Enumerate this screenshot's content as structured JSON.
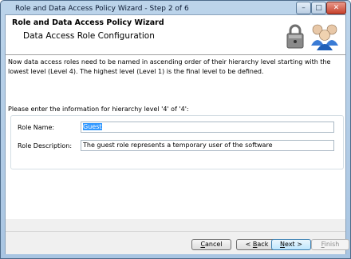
{
  "window": {
    "title": "Role and Data Access Policy Wizard - Step 2 of 6",
    "minimize_glyph": "–",
    "maximize_glyph": "□",
    "close_glyph": "✕"
  },
  "header": {
    "title": "Role and Data Access Policy Wizard",
    "subtitle": "Data Access Role Configuration",
    "icons": [
      "lock-icon",
      "users-icon"
    ]
  },
  "content": {
    "intro": "Now data access roles need to be named in ascending order of their hierarchy level starting with the lowest level (Level 4). The highest level (Level 1) is the final level to be defined.",
    "info": "Please enter the information for hierarchy level '4' of '4':",
    "role_name_label": "Role Name:",
    "role_name_value": "Guest",
    "role_desc_label": "Role Description:",
    "role_desc_value": "The guest role represents a temporary user of the software"
  },
  "buttons": {
    "cancel_u": "C",
    "cancel_rest": "ancel",
    "back_pre": "< ",
    "back_u": "B",
    "back_rest": "ack",
    "next_u": "N",
    "next_rest": "ext >",
    "finish_u": "F",
    "finish_rest": "inish"
  }
}
